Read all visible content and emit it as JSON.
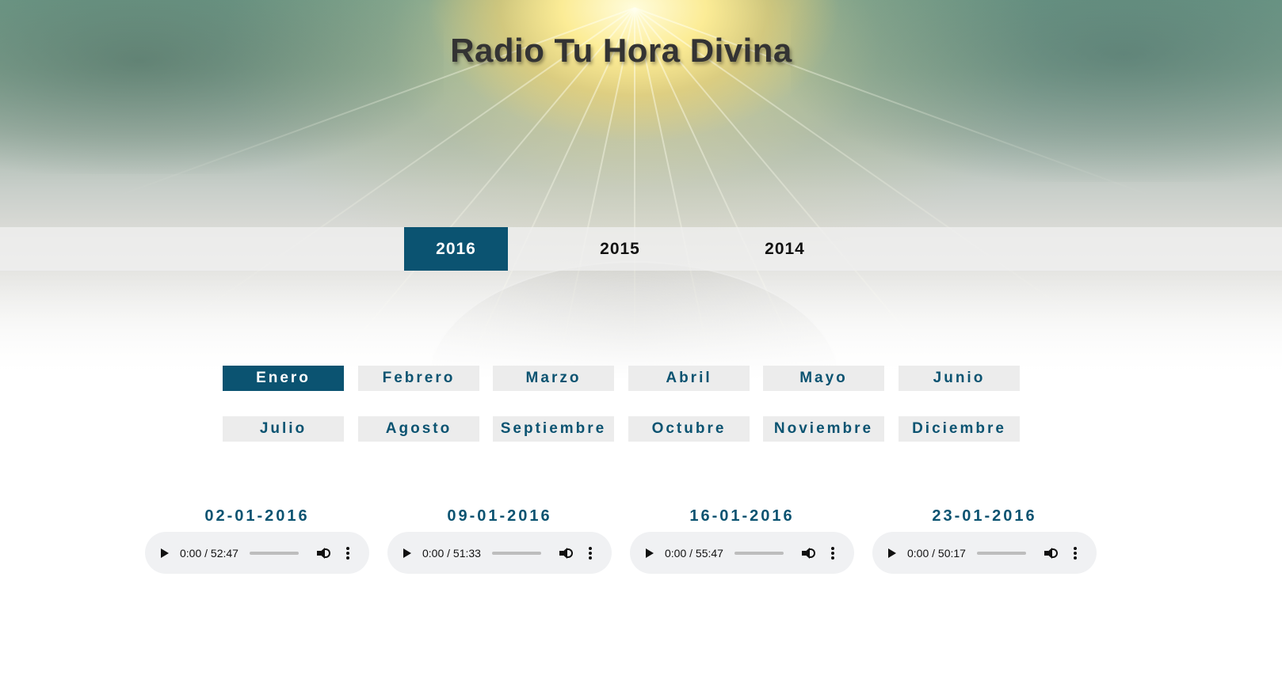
{
  "site": {
    "title": "Radio Tu Hora Divina"
  },
  "years": {
    "items": [
      {
        "label": "2016",
        "active": true
      },
      {
        "label": "2015",
        "active": false
      },
      {
        "label": "2014",
        "active": false
      }
    ]
  },
  "months": {
    "items": [
      {
        "label": "Enero",
        "active": true
      },
      {
        "label": "Febrero",
        "active": false
      },
      {
        "label": "Marzo",
        "active": false
      },
      {
        "label": "Abril",
        "active": false
      },
      {
        "label": "Mayo",
        "active": false
      },
      {
        "label": "Junio",
        "active": false
      },
      {
        "label": "Julio",
        "active": false
      },
      {
        "label": "Agosto",
        "active": false
      },
      {
        "label": "Septiembre",
        "active": false
      },
      {
        "label": "Octubre",
        "active": false
      },
      {
        "label": "Noviembre",
        "active": false
      },
      {
        "label": "Diciembre",
        "active": false
      }
    ]
  },
  "episodes": {
    "items": [
      {
        "date": "02-01-2016",
        "time": "0:00 / 52:47"
      },
      {
        "date": "09-01-2016",
        "time": "0:00 / 51:33"
      },
      {
        "date": "16-01-2016",
        "time": "0:00 / 55:47"
      },
      {
        "date": "23-01-2016",
        "time": "0:00 / 50:17"
      }
    ]
  },
  "colors": {
    "accent": "#0b5371",
    "button_bg": "#ececec",
    "player_bg": "#f0f1f3"
  },
  "icons": {
    "play": "play-icon",
    "volume": "volume-icon",
    "more": "more-options-icon"
  }
}
